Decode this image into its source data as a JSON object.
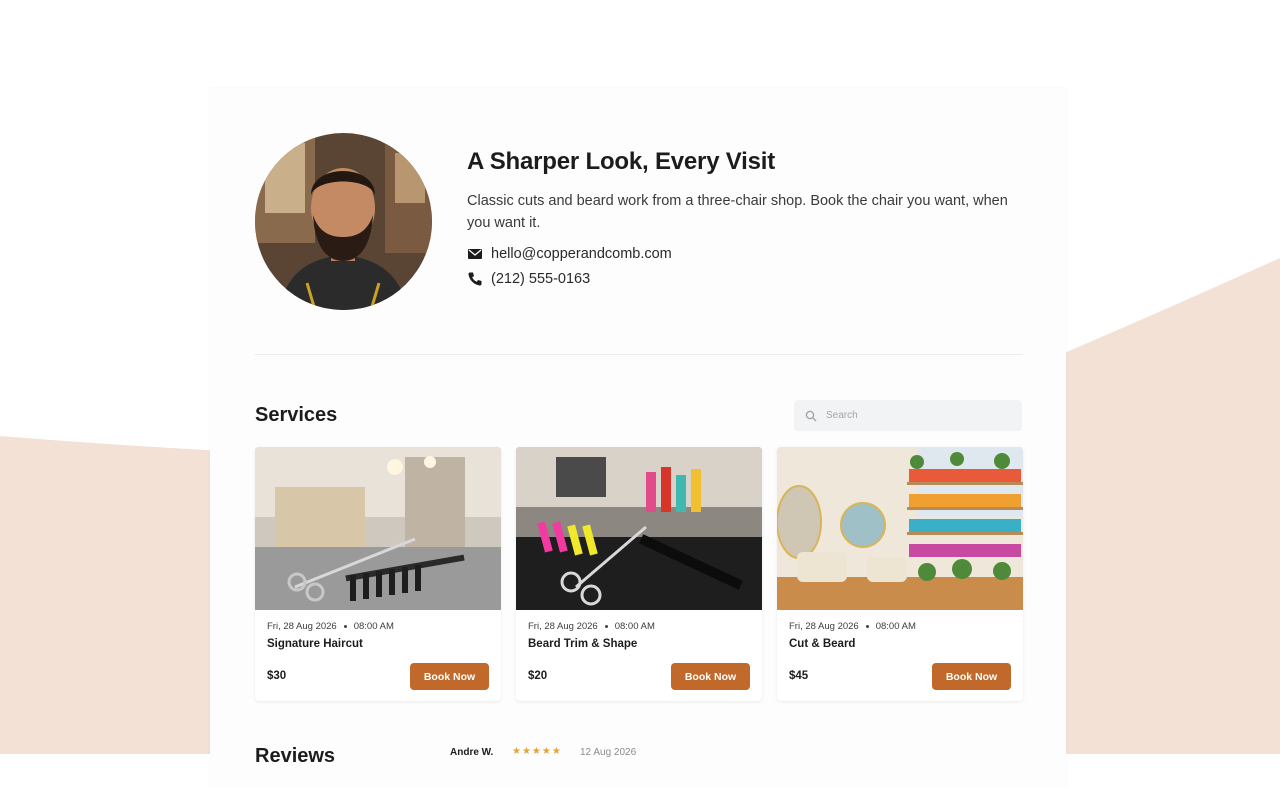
{
  "hero": {
    "title": "A Sharper Look, Every Visit",
    "subtitle": "Classic cuts and beard work from a three-chair shop. Book the chair you want, when you want it.",
    "email": "hello@copperandcomb.com",
    "phone": "(212) 555-0163"
  },
  "services": {
    "title": "Services",
    "search_placeholder": "Search",
    "items": [
      {
        "date": "Fri, 28 Aug 2026",
        "time": "08:00 AM",
        "name": "Signature Haircut",
        "price": "$30",
        "button": "Book Now"
      },
      {
        "date": "Fri, 28 Aug 2026",
        "time": "08:00 AM",
        "name": "Beard Trim & Shape",
        "price": "$20",
        "button": "Book Now"
      },
      {
        "date": "Fri, 28 Aug 2026",
        "time": "08:00 AM",
        "name": "Cut & Beard",
        "price": "$45",
        "button": "Book Now"
      }
    ]
  },
  "reviews": {
    "title": "Reviews",
    "first_reviewer": "Andre W.",
    "first_stars": "★★★★★",
    "first_date": "12 Aug 2026"
  },
  "colors": {
    "accent": "#c0692a",
    "background_shape": "#f3e1d6"
  }
}
